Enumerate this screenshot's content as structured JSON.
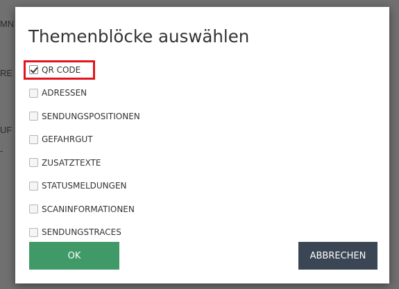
{
  "dialog": {
    "title": "Themenblöcke auswählen",
    "options": [
      {
        "label": "QR CODE",
        "checked": true,
        "highlighted": true
      },
      {
        "label": "ADRESSEN",
        "checked": false
      },
      {
        "label": "SENDUNGSPOSITIONEN",
        "checked": false
      },
      {
        "label": "GEFAHRGUT",
        "checked": false
      },
      {
        "label": "ZUSATZTEXTE",
        "checked": false
      },
      {
        "label": "STATUSMELDUNGEN",
        "checked": false
      },
      {
        "label": "SCANINFORMATIONEN",
        "checked": false
      },
      {
        "label": "SENDUNGSTRACES",
        "checked": false
      }
    ],
    "ok_label": "OK",
    "cancel_label": "ABBRECHEN"
  },
  "background": {
    "fragments": [
      "MN",
      "RE",
      "UF",
      "-"
    ]
  },
  "colors": {
    "ok_button": "#3f9a67",
    "cancel_button": "#3a4653",
    "highlight": "#e3121b",
    "overlay": "#707070"
  }
}
